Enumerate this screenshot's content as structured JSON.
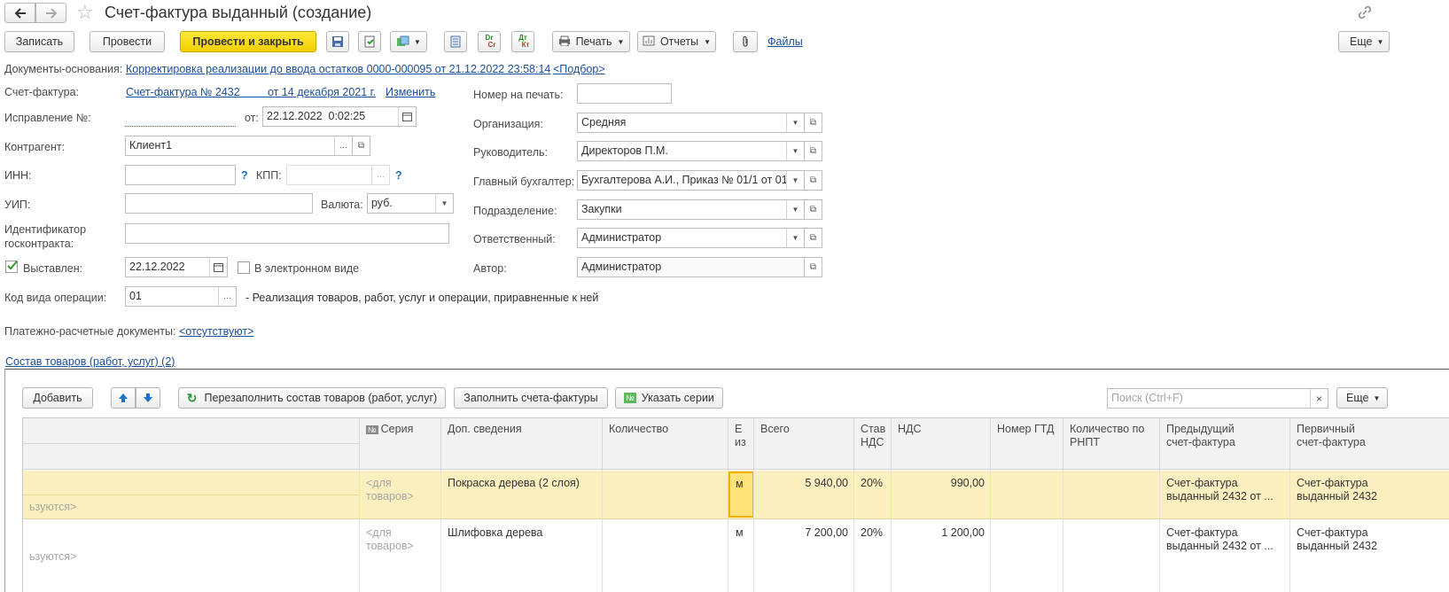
{
  "window": {
    "title": "Счет-фактура выданный (создание)"
  },
  "toolbar": {
    "write": "Записать",
    "post": "Провести",
    "post_close": "Провести и закрыть",
    "print": "Печать",
    "reports": "Отчеты",
    "files": "Файлы",
    "more": "Еще",
    "dr_top": "Dr",
    "dr_bottom": "Cr",
    "dt_top": "Дт",
    "dt_bottom": "Кт"
  },
  "basis": {
    "label": "Документы-основания:",
    "link": "Корректировка реализации до ввода остатков 0000-000095 от 21.12.2022 23:58:14",
    "select": "<Подбор>"
  },
  "form": {
    "invoice_label": "Счет-фактура:",
    "invoice_link": "Счет-фактура № 2432         от 14 декабря 2021 г.",
    "invoice_change": "Изменить",
    "correction_label": "Исправление №:",
    "from_label": "от:",
    "correction_date": "22.12.2022  0:02:25",
    "counterparty_label": "Контрагент:",
    "counterparty": "Клиент1",
    "inn_label": "ИНН:",
    "kpp_label": "КПП:",
    "question": "?",
    "uip_label": "УИП:",
    "currency_label": "Валюта:",
    "currency": "руб.",
    "contract_label_1": "Идентификатор",
    "contract_label_2": "госконтракта:",
    "issued_label": "Выставлен:",
    "issued_date": "22.12.2022",
    "electronic_label": "В электронном виде",
    "op_code_label": "Код вида операции:",
    "op_code": "01",
    "op_code_desc": "- Реализация товаров, работ, услуг и операции, приравненные к ней",
    "print_number_label": "Номер на печать:",
    "org_label": "Организация:",
    "org": "Средняя",
    "head_label": "Руководитель:",
    "head": "Директоров П.М.",
    "accountant_label": "Главный бухгалтер:",
    "accountant": "Бухгалтерова А.И., Приказ № 01/1 от 01",
    "division_label": "Подразделение:",
    "division": "Закупки",
    "responsible_label": "Ответственный:",
    "responsible": "Администратор",
    "author_label": "Автор:",
    "author": "Администратор",
    "payment_label": "Платежно-расчетные документы:",
    "payment_link": "<отсутствуют>"
  },
  "goods": {
    "section_link": "Состав товаров (работ, услуг) (2)",
    "add": "Добавить",
    "refill": "Перезаполнить состав товаров (работ, услуг)",
    "fill_invoices": "Заполнить счета-фактуры",
    "series": "Указать серии",
    "search_placeholder": "Поиск (Ctrl+F)",
    "more": "Еще",
    "columns": {
      "series": "Серия",
      "extra": "Доп. сведения",
      "qty": "Количество",
      "unit_1": "Е",
      "unit_2": "из",
      "total": "Всего",
      "rate_1": "Став",
      "rate_2": "НДС",
      "vat": "НДС",
      "gtd": "Номер ГТД",
      "rnpt_1": "Количество по",
      "rnpt_2": "РНПТ",
      "prev_1": "Предыдущий",
      "prev_2": "счет-фактура",
      "primary_1": "Первичный",
      "primary_2": "счет-фактура"
    },
    "rows": [
      {
        "left": "ьзуются>",
        "series_1": "<для",
        "series_2": "товаров>",
        "extra": "Покраска дерева (2 слоя)",
        "unit": "м",
        "total": "5 940,00",
        "rate": "20%",
        "vat": "990,00",
        "prev_1": "Счет-фактура",
        "prev_2": "выданный 2432 от ...",
        "primary_1": "Счет-фактура",
        "primary_2": "выданный 2432"
      },
      {
        "left": "ьзуются>",
        "series_1": "<для",
        "series_2": "товаров>",
        "extra": "Шлифовка дерева",
        "unit": "м",
        "total": "7 200,00",
        "rate": "20%",
        "vat": "1 200,00",
        "prev_1": "Счет-фактура",
        "prev_2": "выданный 2432 от ...",
        "primary_1": "Счет-фактура",
        "primary_2": "выданный 2432"
      }
    ]
  }
}
